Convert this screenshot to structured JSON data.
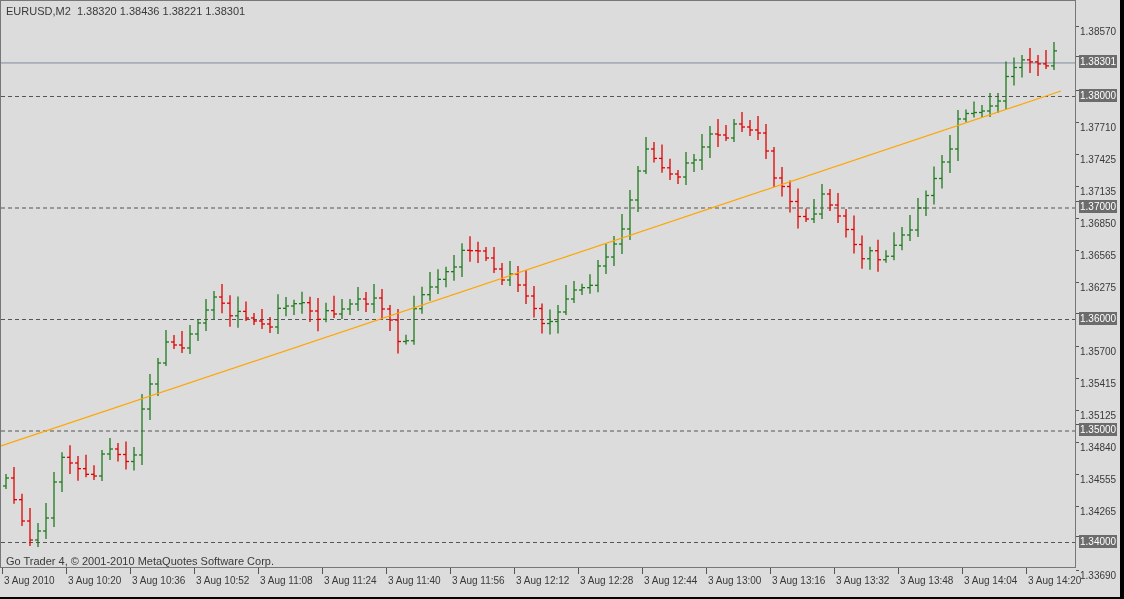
{
  "chart_header": {
    "symbol": "EURUSD,M2",
    "quote": "1.38320 1.38436 1.38221 1.38301"
  },
  "copyright": "Go Trader 4, © 2001-2010 MetaQuotes Software Corp.",
  "price_axis": [
    {
      "label": "1.38570",
      "kind": "tick"
    },
    {
      "label": "1.38301",
      "kind": "current"
    },
    {
      "label": "1.38000",
      "kind": "level"
    },
    {
      "label": "1.37710",
      "kind": "tick"
    },
    {
      "label": "1.37425",
      "kind": "tick"
    },
    {
      "label": "1.37135",
      "kind": "tick"
    },
    {
      "label": "1.37000",
      "kind": "level"
    },
    {
      "label": "1.36850",
      "kind": "tick"
    },
    {
      "label": "1.36565",
      "kind": "tick"
    },
    {
      "label": "1.36275",
      "kind": "tick"
    },
    {
      "label": "1.36000",
      "kind": "level"
    },
    {
      "label": "1.35700",
      "kind": "tick"
    },
    {
      "label": "1.35415",
      "kind": "tick"
    },
    {
      "label": "1.35125",
      "kind": "tick"
    },
    {
      "label": "1.35000",
      "kind": "level"
    },
    {
      "label": "1.34840",
      "kind": "tick"
    },
    {
      "label": "1.34555",
      "kind": "tick"
    },
    {
      "label": "1.34265",
      "kind": "tick"
    },
    {
      "label": "1.34000",
      "kind": "level"
    },
    {
      "label": "1.33690",
      "kind": "tick"
    }
  ],
  "time_axis": [
    "3 Aug 2010",
    "3 Aug 10:20",
    "3 Aug 10:36",
    "3 Aug 10:52",
    "3 Aug 11:08",
    "3 Aug 11:24",
    "3 Aug 11:40",
    "3 Aug 11:56",
    "3 Aug 12:12",
    "3 Aug 12:28",
    "3 Aug 12:44",
    "3 Aug 13:00",
    "3 Aug 13:16",
    "3 Aug 13:32",
    "3 Aug 13:48",
    "3 Aug 14:04",
    "3 Aug 14:20"
  ]
}
